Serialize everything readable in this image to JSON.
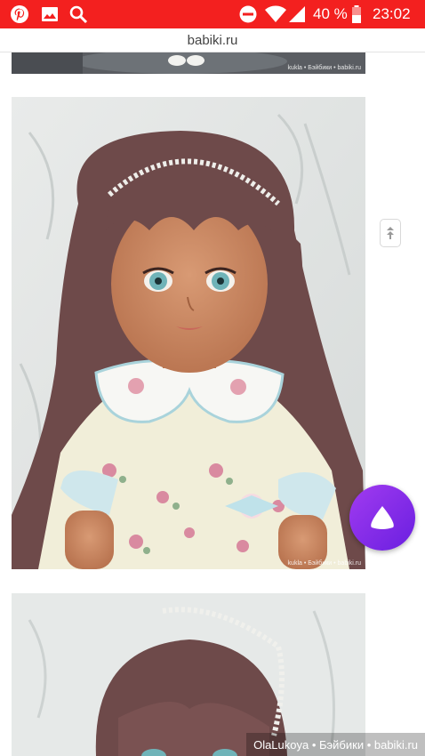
{
  "status_bar": {
    "icons": [
      "pinterest-icon",
      "gallery-icon",
      "search-icon",
      "do-not-disturb-icon",
      "wifi-icon",
      "signal-icon",
      "battery-icon"
    ],
    "battery_percent": "40 %",
    "time": "23:02",
    "background_color": "#f3201f"
  },
  "browser": {
    "url": "babiki.ru"
  },
  "photos": [
    {
      "watermark": "kukla • Бэйбики • babiki.ru"
    },
    {
      "watermark": "kukla • Бэйбики • babiki.ru"
    },
    {
      "watermark": ""
    }
  ],
  "floating": {
    "scroll_button_icon": "scroll-up-icon",
    "assistant_icon": "alice-assistant-icon",
    "assistant_color": "#8a2be2"
  },
  "footer_watermark": "OlaLukoya • Бэйбики • babiki.ru"
}
